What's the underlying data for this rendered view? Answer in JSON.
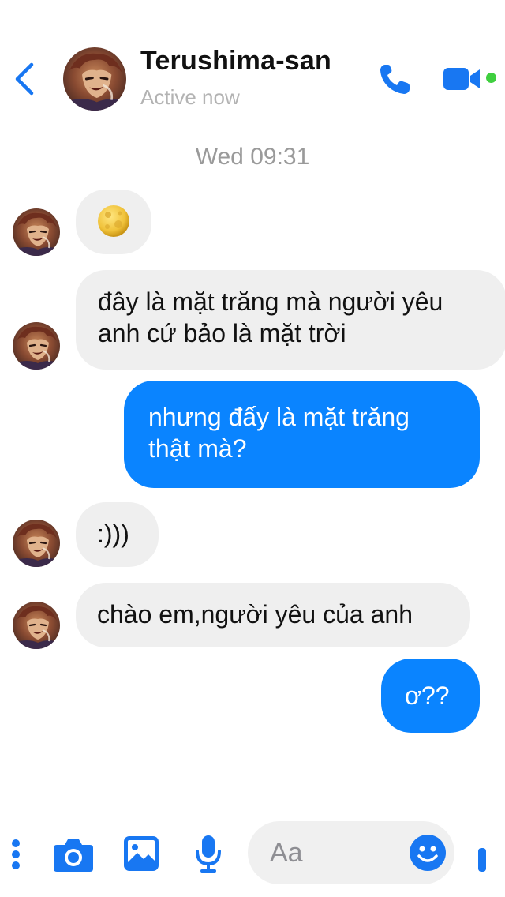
{
  "header": {
    "contact_name": "Terushima-san",
    "status": "Active now"
  },
  "timestamp": "Wed 09:31",
  "messages": [
    {
      "from": "them",
      "type": "emoji",
      "text": ""
    },
    {
      "from": "them",
      "type": "text",
      "lines": [
        "đây là mặt trăng mà người yêu",
        "anh cứ bảo là mặt trời"
      ]
    },
    {
      "from": "me",
      "type": "text",
      "lines": [
        "nhưng đấy là mặt trăng",
        "thật mà?"
      ]
    },
    {
      "from": "them",
      "type": "text",
      "lines": [
        ":)))"
      ]
    },
    {
      "from": "them",
      "type": "text",
      "lines": [
        "chào em,người yêu của anh"
      ]
    },
    {
      "from": "me",
      "type": "text",
      "lines": [
        "ơ??"
      ]
    }
  ],
  "composer": {
    "placeholder": "Aa"
  },
  "colors": {
    "accent": "#0a84ff",
    "icon_blue": "#1877f2",
    "incoming_bubble": "#efefef",
    "online": "#3fcf3f"
  },
  "icons": [
    "chevron-left-icon",
    "phone-icon",
    "video-icon",
    "more-dots-icon",
    "camera-icon",
    "image-icon",
    "microphone-icon",
    "smiley-icon",
    "moon-emoji"
  ]
}
